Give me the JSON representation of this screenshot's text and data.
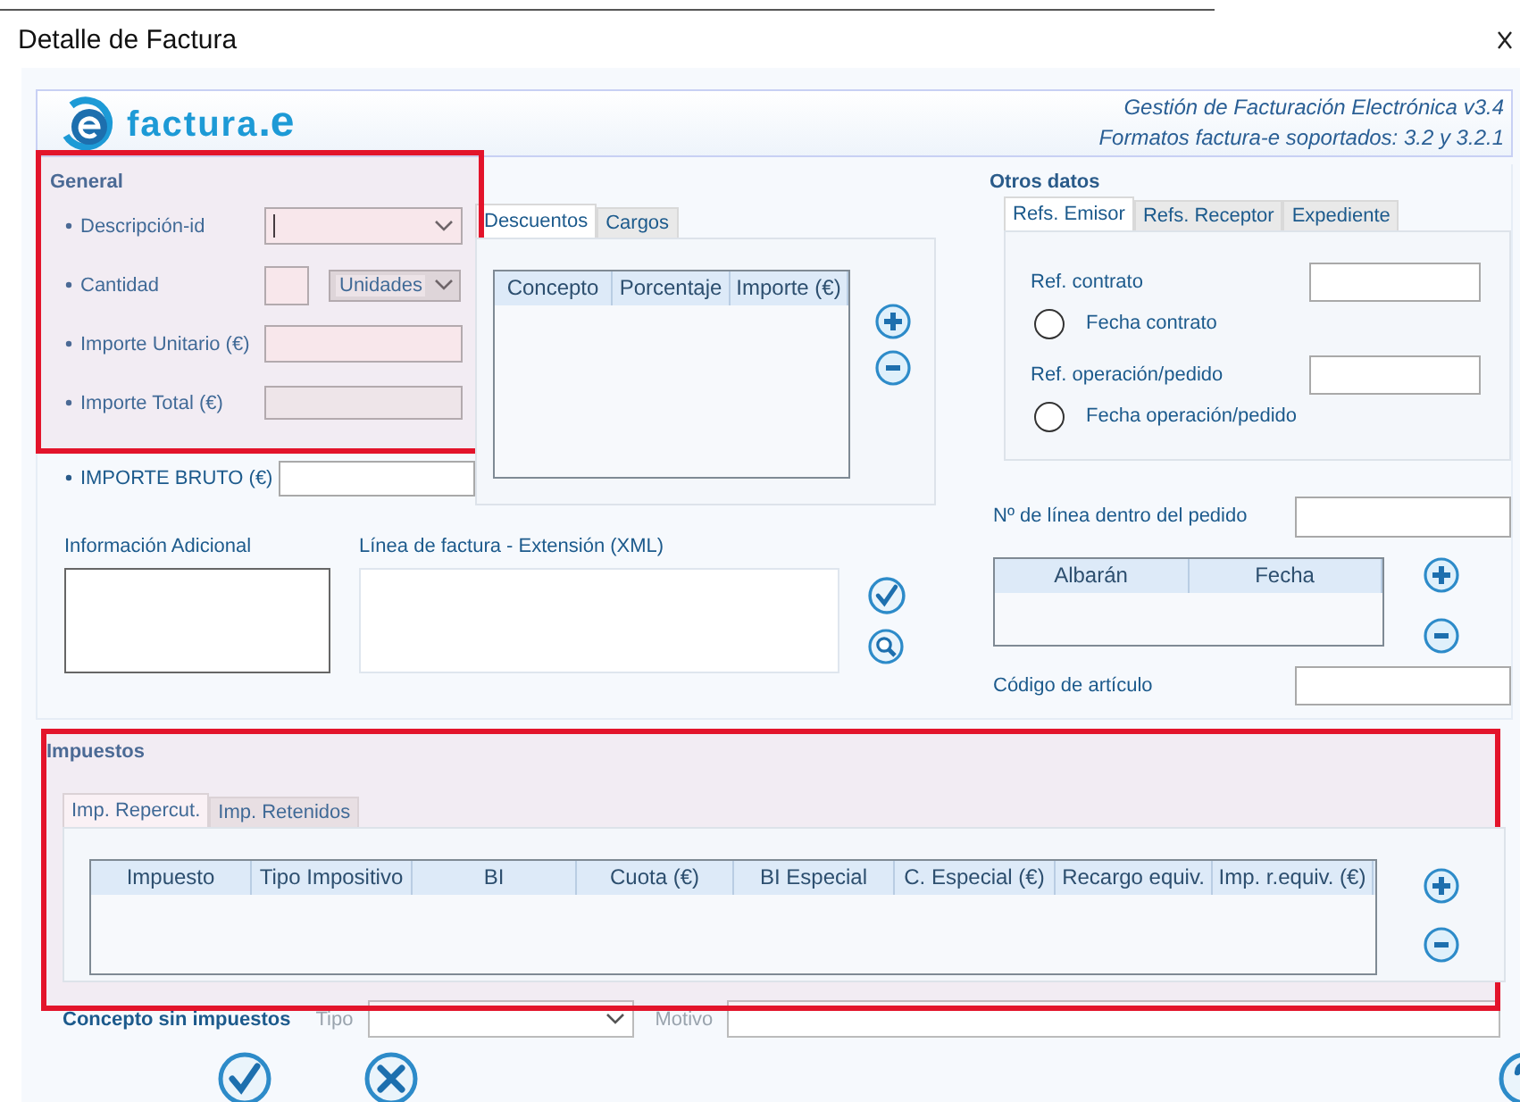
{
  "window": {
    "title": "Detalle de Factura"
  },
  "header": {
    "logo_word": "factura",
    "logo_suffix": ".e",
    "lines": [
      "Gestión de Facturación Electrónica v3.4",
      "Formatos factura-e soportados: 3.2 y 3.2.1"
    ]
  },
  "general": {
    "title": "General",
    "highlighted": true,
    "fields": [
      {
        "label": "Descripción-id",
        "required": true,
        "kind": "select"
      },
      {
        "label": "Cantidad",
        "required": true,
        "kind": "quantity",
        "unit": "Unidades"
      },
      {
        "label": "Importe Unitario (€)",
        "required": true,
        "kind": "text"
      },
      {
        "label": "Importe Total (€)",
        "required": true,
        "kind": "readonly"
      }
    ],
    "gross": {
      "label": "IMPORTE BRUTO (€)",
      "required": true
    }
  },
  "discounts": {
    "tabs": [
      {
        "label": "Descuentos",
        "selected": true
      },
      {
        "label": "Cargos",
        "selected": false
      }
    ],
    "columns": [
      "Concepto",
      "Porcentaje",
      "Importe (€)"
    ]
  },
  "other": {
    "title": "Otros datos",
    "tabs": [
      {
        "label": "Refs. Emisor",
        "selected": true
      },
      {
        "label": "Refs. Receptor",
        "selected": false
      },
      {
        "label": "Expediente",
        "selected": false
      }
    ],
    "refs": [
      {
        "label": "Ref. contrato",
        "date_label": "Fecha contrato",
        "checked": false
      },
      {
        "label": "Ref. operación/pedido",
        "date_label": "Fecha operación/pedido",
        "checked": false
      }
    ],
    "line_number_label": "Nº de línea dentro del pedido",
    "delivery_columns": [
      "Albarán",
      "Fecha"
    ],
    "article_label": "Código de artículo"
  },
  "info": {
    "additional_label": "Información Adicional",
    "xml_label": "Línea de factura - Extensión (XML)"
  },
  "taxes": {
    "title": "Impuestos",
    "highlighted": true,
    "tabs": [
      {
        "label": "Imp. Repercut.",
        "selected": true
      },
      {
        "label": "Imp. Retenidos",
        "selected": false
      }
    ],
    "columns": [
      "Impuesto",
      "Tipo Impositivo",
      "BI",
      "Cuota (€)",
      "BI Especial",
      "C. Especial (€)",
      "Recargo equiv.",
      "Imp. r.equiv. (€)"
    ]
  },
  "exempt": {
    "label": "Concepto sin impuestos",
    "type_label": "Tipo",
    "reason_label": "Motivo",
    "disabled": true
  }
}
